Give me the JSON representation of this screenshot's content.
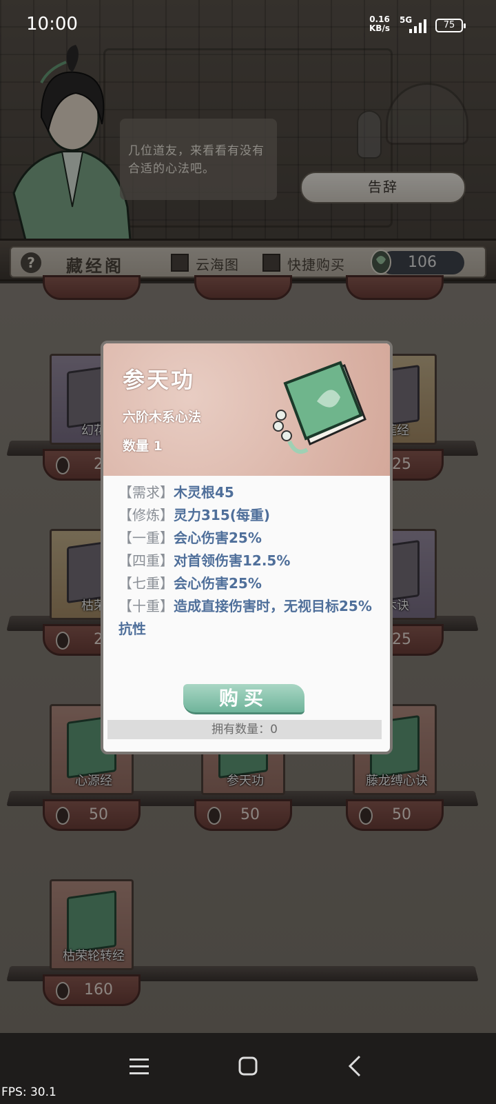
{
  "status_bar": {
    "time": "10:00",
    "net_speed_value": "0.16",
    "net_speed_unit": "KB/s",
    "network": "5G",
    "battery": "75"
  },
  "npc": {
    "dialogue": "几位道友，来看看有没有合适的心法吧。",
    "leave_label": "告辞"
  },
  "tabbar": {
    "help": "?",
    "title": "藏经阁",
    "option1": "云海图",
    "option2": "快捷购买",
    "currency": "106"
  },
  "shop_items": [
    {
      "name": "幻花",
      "price": "2",
      "style": "purple"
    },
    {
      "name": "莲经",
      "price": "25",
      "style": "gold"
    },
    {
      "name": "枯荣",
      "price": "2",
      "style": "gold"
    },
    {
      "name": "木诀",
      "price": "25",
      "style": "purple"
    },
    {
      "name": "心源经",
      "price": "50",
      "style": "red"
    },
    {
      "name": "参天功",
      "price": "50",
      "style": "red"
    },
    {
      "name": "藤龙缚心诀",
      "price": "50",
      "style": "red"
    },
    {
      "name": "枯荣轮转经",
      "price": "160",
      "style": "red"
    }
  ],
  "modal": {
    "title": "参天功",
    "subtitle": "六阶木系心法",
    "quantity": "数量 1",
    "effects": [
      {
        "tag": "【需求】",
        "text": "木灵根45"
      },
      {
        "tag": "【修炼】",
        "text": "灵力315(每重)"
      },
      {
        "tag": "【一重】",
        "text": "会心伤害25%"
      },
      {
        "tag": "【四重】",
        "text": "对首领伤害12.5%"
      },
      {
        "tag": "【七重】",
        "text": "会心伤害25%"
      },
      {
        "tag": "【十重】",
        "text": "造成直接伤害时，无视目标25%抗性"
      }
    ],
    "buy_label": "购买",
    "owned": "拥有数量：0"
  },
  "system": {
    "fps": "FPS: 30.1"
  }
}
